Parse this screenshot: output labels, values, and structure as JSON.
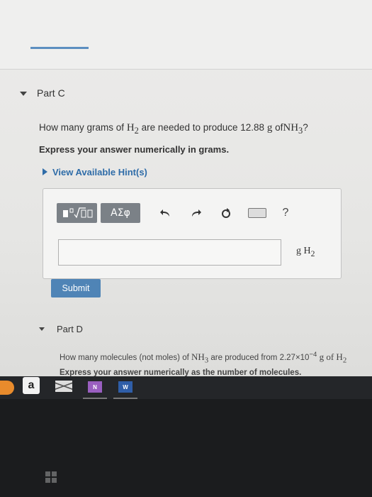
{
  "part_c": {
    "title": "Part C",
    "question_prefix": "How many grams of",
    "question_h2": "H",
    "question_h2_sub": "2",
    "question_mid": "are needed to produce 12.88",
    "question_unit_g": "g",
    "question_of": "of",
    "question_nh3": "NH",
    "question_nh3_sub": "3",
    "question_end": "?",
    "instruction": "Express your answer numerically in grams.",
    "hint_label": "View Available Hint(s)",
    "toolbar": {
      "greek_label": "ΑΣφ",
      "help_label": "?"
    },
    "input_value": "",
    "unit_g": "g",
    "unit_h": "H",
    "unit_sub": "2",
    "submit_label": "Submit"
  },
  "part_d": {
    "title": "Part D",
    "question_prefix": "How many molecules (not moles) of",
    "question_nh3": "NH",
    "question_nh3_sub": "3",
    "question_mid": "are produced from 2.27×10",
    "question_exp": "−4",
    "question_unit": "g of H",
    "question_unit_sub": "2",
    "instruction": "Express your answer numerically as the number of molecules."
  },
  "dock": {
    "amazon_label": "a",
    "onenote_label": "N",
    "word_label": "W"
  },
  "colors": {
    "accent": "#4f84b6",
    "hint_link": "#2f6ca8",
    "toolbar_button": "#7b8187"
  }
}
